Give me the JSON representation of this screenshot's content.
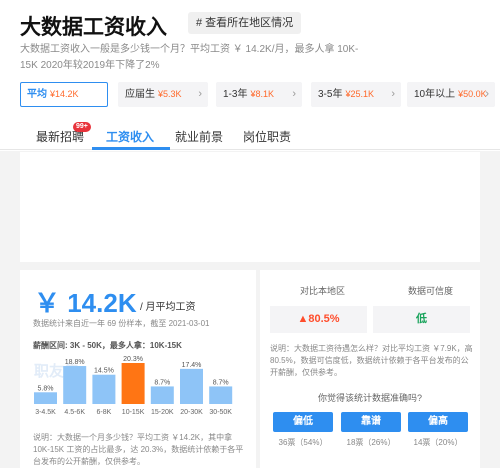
{
  "header": {
    "title": "大数据工资收入",
    "region_tag": "# 查看所在地区情况",
    "subtitle": "大数据工资收入一般是多少钱一个月？平均工资 ￥ 14.2K/月，最多人拿 10K-15K 2020年较2019年下降了2%"
  },
  "levels": [
    {
      "label": "平均",
      "value": "¥14.2K"
    },
    {
      "label": "应届生",
      "value": "¥5.3K"
    },
    {
      "label": "1-3年",
      "value": "¥8.1K"
    },
    {
      "label": "3-5年",
      "value": "¥25.1K"
    },
    {
      "label": "10年以上",
      "value": "¥50.0K"
    }
  ],
  "tabs": [
    {
      "label": "最新招聘",
      "badge": "99+"
    },
    {
      "label": "工资收入"
    },
    {
      "label": "就业前景"
    },
    {
      "label": "岗位职责"
    }
  ],
  "left": {
    "avg": "￥ 14.2K",
    "unit": "/ 月平均工资",
    "stat_note": "数据统计来自近一年 69 份样本，截至 2021-03-01",
    "range_note": "薪酬区间: 3K - 50K，最多人拿：10K-15K",
    "watermark": "职友集",
    "explain": "说明：大数据一个月多少钱？平均工资 ￥14.2K，其中拿 10K-15K 工资的占比最多，达 20.3%，数据统计依赖于各平台发布的公开薪酬，仅供参考。"
  },
  "chart_data": {
    "type": "bar",
    "categories": [
      "3-4.5K",
      "4.5-6K",
      "6-8K",
      "10-15K",
      "15-20K",
      "20-30K",
      "30-50K"
    ],
    "values": [
      5.8,
      18.8,
      14.5,
      20.3,
      8.7,
      17.4,
      8.7
    ],
    "value_labels": [
      "5.8%",
      "18.8%",
      "14.5%",
      "20.3%",
      "8.7%",
      "17.4%",
      "8.7%"
    ],
    "highlight_index": 3,
    "colors": {
      "bar": "#8ec4f7",
      "highlight": "#ff7514"
    }
  },
  "right": {
    "compare_label": "对比本地区",
    "compare_value": "80.5%",
    "credibility_label": "数据可信度",
    "credibility_value": "低",
    "explain": "说明：大数据工资待遇怎么样？对比平均工资 ￥7.9K，高 80.5%，数据可信度低，数据统计依赖于各平台发布的公开薪酬，仅供参考。",
    "question": "你觉得该统计数据准确吗?",
    "votes": [
      {
        "label": "偏低",
        "count": "36票（54%）"
      },
      {
        "label": "靠谱",
        "count": "18票（26%）"
      },
      {
        "label": "偏高",
        "count": "14票（20%）"
      }
    ]
  },
  "colors": {
    "accent": "#2e8ef0",
    "orange": "#ff6a2c",
    "badge": "#e8333b",
    "green": "#1aa35c"
  }
}
